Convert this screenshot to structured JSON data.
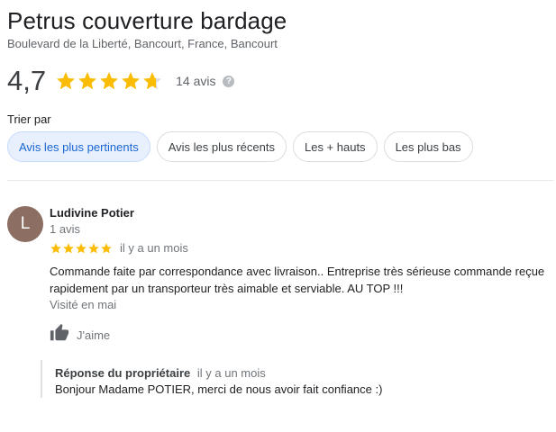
{
  "place": {
    "title": "Petrus couverture bardage",
    "address": "Boulevard de la Liberté, Bancourt, France, Bancourt"
  },
  "summary": {
    "rating": "4,7",
    "rating_value": 4.7,
    "review_count": "14 avis",
    "help_glyph": "?"
  },
  "sort": {
    "label": "Trier par",
    "chips": [
      {
        "label": "Avis les plus pertinents",
        "active": true
      },
      {
        "label": "Avis les plus récents",
        "active": false
      },
      {
        "label": "Les + hauts",
        "active": false
      },
      {
        "label": "Les plus bas",
        "active": false
      }
    ]
  },
  "review": {
    "avatar_letter": "L",
    "author": "Ludivine Potier",
    "author_meta": "1 avis",
    "stars": 5,
    "time": "il y a un mois",
    "text": "Commande faite par correspondance avec livraison.. Entreprise très sérieuse commande reçue rapidement par un transporteur très aimable et serviable. AU TOP !!!",
    "visited": "Visité en mai",
    "like_label": "J'aime",
    "reply": {
      "owner_label": "Réponse du propriétaire",
      "time": "il y a un mois",
      "text": "Bonjour Madame POTIER, merci de nous avoir fait confiance :)"
    }
  },
  "colors": {
    "star": "#fbbc04",
    "star_empty": "#dadce0",
    "accent": "#1967d2",
    "avatar": "#8d6e63"
  },
  "icons": [
    "star-icon",
    "help-icon",
    "thumbs-up-icon"
  ]
}
